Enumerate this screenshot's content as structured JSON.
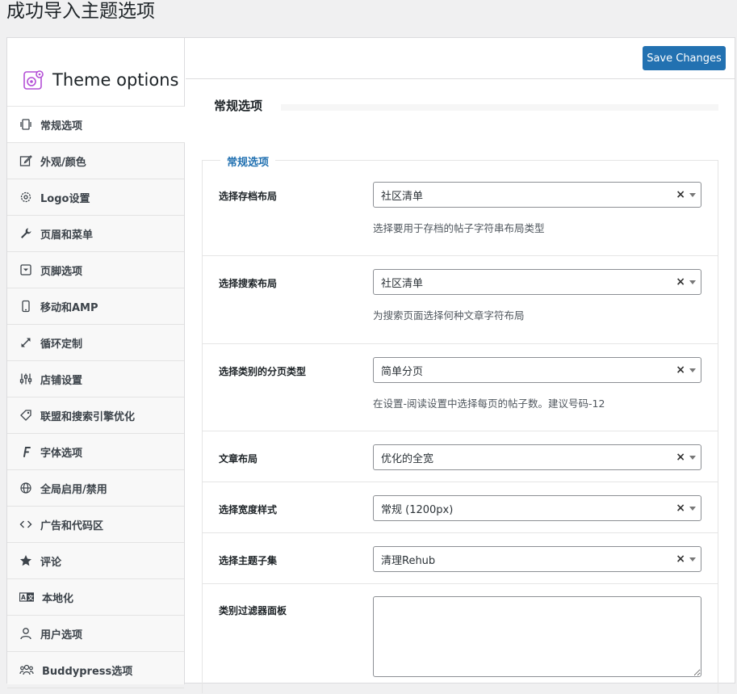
{
  "page": {
    "heading": "成功导入主题选项"
  },
  "brand": {
    "title": "Theme options"
  },
  "toolbar": {
    "save_label": "Save Changes"
  },
  "sidebar": {
    "items": [
      {
        "label": "常规选项",
        "icon": "sliders-vertical-icon"
      },
      {
        "label": "外观/颜色",
        "icon": "edit-icon"
      },
      {
        "label": "Logo设置",
        "icon": "gear-icon"
      },
      {
        "label": "页眉和菜单",
        "icon": "wrench-icon"
      },
      {
        "label": "页脚选项",
        "icon": "caret-box-icon"
      },
      {
        "label": "移动和AMP",
        "icon": "mobile-icon"
      },
      {
        "label": "循环定制",
        "icon": "expand-arrows-icon"
      },
      {
        "label": "店铺设置",
        "icon": "sliders-icon"
      },
      {
        "label": "联盟和搜索引擎优化",
        "icon": "tag-icon"
      },
      {
        "label": "字体选项",
        "icon": "font-icon"
      },
      {
        "label": "全局启用/禁用",
        "icon": "globe-icon"
      },
      {
        "label": "广告和代码区",
        "icon": "code-icon"
      },
      {
        "label": "评论",
        "icon": "star-icon"
      },
      {
        "label": "本地化",
        "icon": "translate-icon"
      },
      {
        "label": "用户选项",
        "icon": "user-icon"
      },
      {
        "label": "Buddypress选项",
        "icon": "users-icon"
      }
    ]
  },
  "main": {
    "section_title": "常规选项",
    "fieldset_legend": "常规选项",
    "rows": [
      {
        "label": "选择存档布局",
        "value": "社区清单",
        "description": "选择要用于存档的帖子字符串布局类型"
      },
      {
        "label": "选择搜索布局",
        "value": "社区清单",
        "description": "为搜索页面选择何种文章字符布局"
      },
      {
        "label": "选择类别的分页类型",
        "value": "简单分页",
        "description": "在设置-阅读设置中选择每页的帖子数。建议号码-12"
      },
      {
        "label": "文章布局",
        "value": "优化的全宽"
      },
      {
        "label": "选择宽度样式",
        "value": "常规 (1200px)"
      },
      {
        "label": "选择主题子集",
        "value": "清理Rehub"
      },
      {
        "label": "类别过滤器面板"
      }
    ],
    "clear_symbol": "×"
  },
  "colors": {
    "accent": "#2271b1",
    "brand_icon": "#b44fd6"
  }
}
